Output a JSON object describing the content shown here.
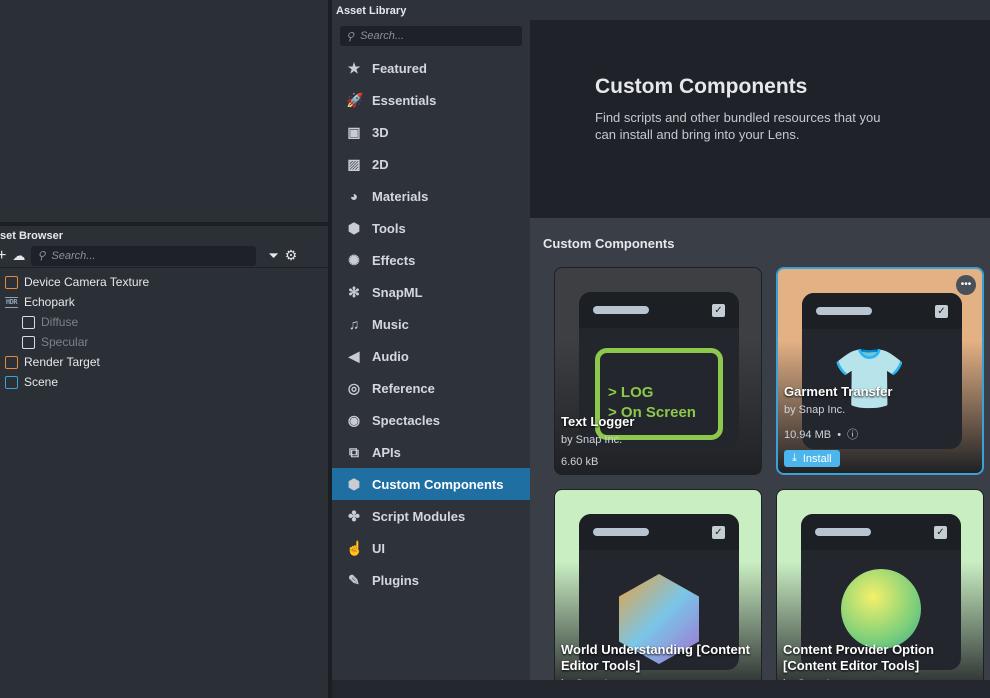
{
  "asset_browser": {
    "title": "set Browser",
    "search_placeholder": "Search...",
    "items": [
      {
        "label": "Device Camera Texture",
        "color": "#e8883a",
        "dim": false,
        "indent": 0
      },
      {
        "label": "Echopark",
        "color": "#8fa0b0",
        "dim": false,
        "indent": 0,
        "badge": "HDR"
      },
      {
        "label": "Diffuse",
        "color": "#d8dce0",
        "dim": true,
        "indent": 1
      },
      {
        "label": "Specular",
        "color": "#d8dce0",
        "dim": true,
        "indent": 1
      },
      {
        "label": "Render Target",
        "color": "#e8883a",
        "dim": false,
        "indent": 0
      },
      {
        "label": "Scene",
        "color": "#3aa0d8",
        "dim": false,
        "indent": 0
      }
    ]
  },
  "library": {
    "title": "Asset Library",
    "search_placeholder": "Search...",
    "categories": [
      {
        "label": "Featured",
        "icon": "★"
      },
      {
        "label": "Essentials",
        "icon": "🚀"
      },
      {
        "label": "3D",
        "icon": "▣"
      },
      {
        "label": "2D",
        "icon": "▨"
      },
      {
        "label": "Materials",
        "icon": "◕"
      },
      {
        "label": "Tools",
        "icon": "⬢"
      },
      {
        "label": "Effects",
        "icon": "✺"
      },
      {
        "label": "SnapML",
        "icon": "✻"
      },
      {
        "label": "Music",
        "icon": "♫"
      },
      {
        "label": "Audio",
        "icon": "◀"
      },
      {
        "label": "Reference",
        "icon": "◎"
      },
      {
        "label": "Spectacles",
        "icon": "◉"
      },
      {
        "label": "APIs",
        "icon": "⧉"
      },
      {
        "label": "Custom Components",
        "icon": "⬢"
      },
      {
        "label": "Script Modules",
        "icon": "✤"
      },
      {
        "label": "UI",
        "icon": "☝"
      },
      {
        "label": "Plugins",
        "icon": "✎"
      }
    ],
    "selected": "Custom Components",
    "hero": {
      "title": "Custom Components",
      "description": "Find scripts and other bundled resources that you can install and bring into your Lens."
    },
    "section_title": "Custom Components",
    "cards": [
      {
        "name": "Text Logger",
        "author": "by Snap Inc.",
        "size": "6.60 kB",
        "bg": "#3d3f42",
        "art": "> LOG\n> On Screen"
      },
      {
        "name": "Garment Transfer",
        "author": "by Snap Inc.",
        "size": "10.94 MB",
        "bg": "#e4b185",
        "install": "Install"
      },
      {
        "name": "World Understanding [Content Editor Tools]",
        "author": "by Snap Inc.",
        "bg": "#c9eec2"
      },
      {
        "name": "Content Provider Option [Content Editor Tools]",
        "author": "by Snap Inc.",
        "bg": "#c9eec2"
      }
    ]
  }
}
